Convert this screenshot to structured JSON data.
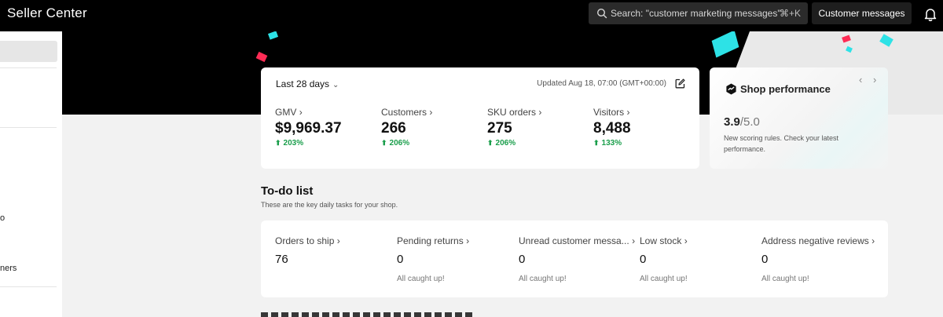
{
  "app": {
    "title": "Seller Center"
  },
  "search": {
    "text": "Search: \"customer marketing messages\"",
    "shortcut": "⌘+K",
    "icon": "search-icon"
  },
  "header": {
    "customer_messages_label": "Customer messages",
    "bell_icon": "bell-icon"
  },
  "sidebar": {
    "fragments": [
      "o",
      "ners"
    ]
  },
  "stats": {
    "date_range": "Last 28 days",
    "updated": "Updated Aug 18, 07:00 (GMT+00:00)",
    "metrics": [
      {
        "label": "GMV",
        "value": "$9,969.37",
        "change": "203%"
      },
      {
        "label": "Customers",
        "value": "266",
        "change": "206%"
      },
      {
        "label": "SKU orders",
        "value": "275",
        "change": "206%"
      },
      {
        "label": "Visitors",
        "value": "8,488",
        "change": "133%"
      }
    ]
  },
  "shop_performance": {
    "title": "Shop performance",
    "score": "3.9",
    "score_max": "/5.0",
    "note": "New scoring rules. Check your latest performance."
  },
  "todo": {
    "title": "To-do list",
    "subtitle": "These are the key daily tasks for your shop.",
    "items": [
      {
        "label": "Orders to ship",
        "value": "76",
        "note": ""
      },
      {
        "label": "Pending returns",
        "value": "0",
        "note": "All caught up!"
      },
      {
        "label": "Unread customer messa...",
        "value": "0",
        "note": "All caught up!"
      },
      {
        "label": "Low stock",
        "value": "0",
        "note": "All caught up!"
      },
      {
        "label": "Address negative reviews",
        "value": "0",
        "note": "All caught up!"
      }
    ]
  },
  "colors": {
    "accent_cyan": "#2de2e6",
    "accent_red": "#fe2c55",
    "positive": "#1a9e4b"
  }
}
